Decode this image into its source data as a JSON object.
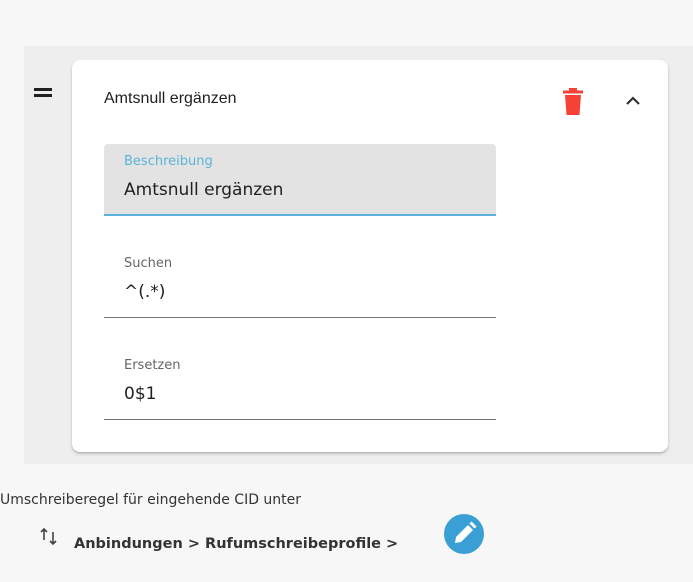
{
  "rule": {
    "title": "Amtsnull ergänzen",
    "fields": [
      {
        "label": "Beschreibung",
        "value": "Amtsnull ergänzen"
      },
      {
        "label": "Suchen",
        "value": "^(.*)"
      },
      {
        "label": "Ersetzen",
        "value": "0$1"
      }
    ]
  },
  "footer": {
    "description": "Umschreiberegel für eingehende CID unter",
    "path": "Anbindungen > Rufumschreibeprofile >"
  },
  "icons": {
    "drag": "drag-handle-icon",
    "delete": "trash-icon",
    "collapse": "chevron-up-icon",
    "sort": "sort-arrows-icon",
    "edit": "pencil-icon"
  },
  "colors": {
    "accent": "#5ab4d9",
    "delete": "#f44336",
    "edit_button": "#3a9fd4"
  }
}
